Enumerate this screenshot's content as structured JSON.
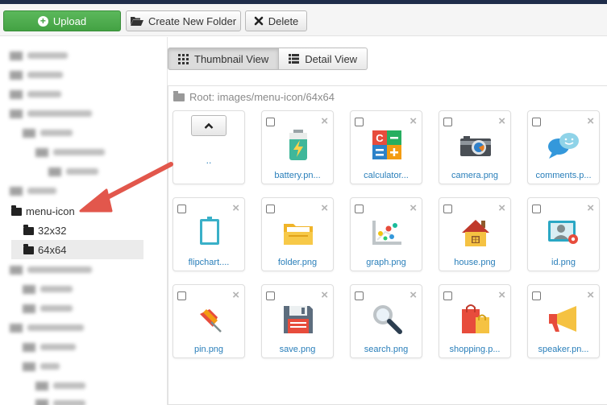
{
  "toolbar": {
    "upload_label": "Upload",
    "new_folder_label": "Create New Folder",
    "delete_label": "Delete"
  },
  "tree": {
    "menu_icon": "menu-icon",
    "child_32": "32x32",
    "child_64": "64x64"
  },
  "views": {
    "thumbnail": "Thumbnail View",
    "detail": "Detail View"
  },
  "breadcrumb": "Root: images/menu-icon/64x64",
  "up_label": "..",
  "files": [
    {
      "label": "battery.pn...",
      "icon": "battery-icon"
    },
    {
      "label": "calculator...",
      "icon": "calculator-icon"
    },
    {
      "label": "camera.png",
      "icon": "camera-icon"
    },
    {
      "label": "comments.p...",
      "icon": "comments-icon"
    },
    {
      "label": "flipchart....",
      "icon": "flipchart-icon"
    },
    {
      "label": "folder.png",
      "icon": "folder-icon"
    },
    {
      "label": "graph.png",
      "icon": "graph-icon"
    },
    {
      "label": "house.png",
      "icon": "house-icon"
    },
    {
      "label": "id.png",
      "icon": "id-card-icon"
    },
    {
      "label": "pin.png",
      "icon": "pin-icon"
    },
    {
      "label": "save.png",
      "icon": "floppy-disk-icon"
    },
    {
      "label": "search.png",
      "icon": "magnifier-icon"
    },
    {
      "label": "shopping.p...",
      "icon": "shopping-bags-icon"
    },
    {
      "label": "speaker.pn...",
      "icon": "megaphone-icon"
    }
  ],
  "colors": {
    "upload_green": "#43a243",
    "link_blue": "#2a7fba",
    "arrow_red": "#e2574c"
  }
}
